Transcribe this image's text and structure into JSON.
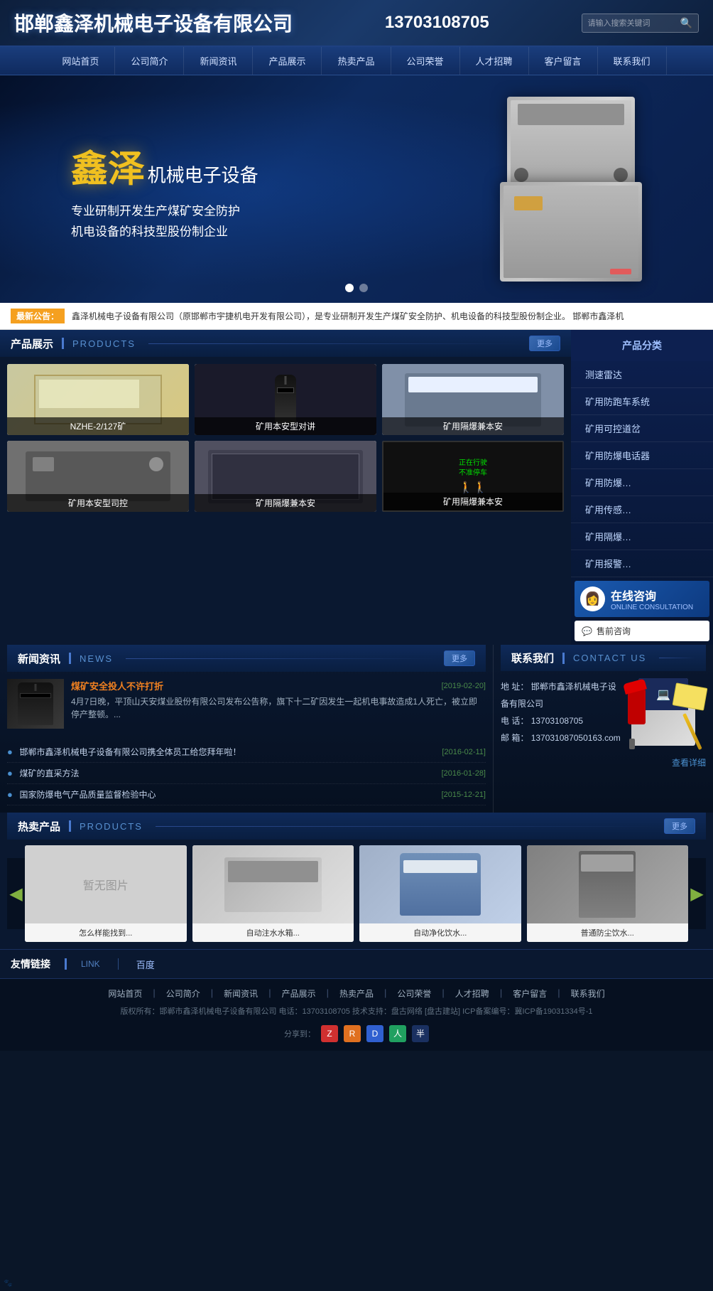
{
  "header": {
    "logo": "邯郸鑫泽机械电子设备有限公司",
    "phone": "13703108705",
    "search_placeholder": "请输入搜索关键词"
  },
  "nav": {
    "items": [
      {
        "label": "网站首页",
        "id": "home"
      },
      {
        "label": "公司简介",
        "id": "about"
      },
      {
        "label": "新闻资讯",
        "id": "news"
      },
      {
        "label": "产品展示",
        "id": "products"
      },
      {
        "label": "热卖产品",
        "id": "hot"
      },
      {
        "label": "公司荣誉",
        "id": "honor"
      },
      {
        "label": "人才招聘",
        "id": "jobs"
      },
      {
        "label": "客户留言",
        "id": "message"
      },
      {
        "label": "联系我们",
        "id": "contact"
      }
    ]
  },
  "banner": {
    "brand_name": "鑫泽",
    "brand_suffix": "机械电子设备",
    "slogan1": "专业研制开发生产煤矿安全防护",
    "slogan2": "机电设备的科技型股份制企业"
  },
  "notice": {
    "label": "最新公告：",
    "text": "鑫泽机械电子设备有限公司（原邯郸市宇捷机电开发有限公司），是专业研制开发生产煤矿安全防护、机电设备的科技型股份制企业。    邯郸市鑫泽机"
  },
  "products_section": {
    "title_zh": "产品展示",
    "title_en": "PRODUCTS",
    "more_label": "更多",
    "items": [
      {
        "label": "NZHE-2/127矿",
        "img_style": "prod-img-1"
      },
      {
        "label": "矿用本安型对讲",
        "img_style": "prod-img-2"
      },
      {
        "label": "矿用隔爆兼本安",
        "img_style": "prod-img-3"
      },
      {
        "label": "矿用本安型司控",
        "img_style": "prod-img-4"
      },
      {
        "label": "矿用隔爆兼本安",
        "img_style": "prod-img-5"
      },
      {
        "label": "矿用隔爆兼本安",
        "img_style": "prod-img-6"
      }
    ]
  },
  "sidebar": {
    "title": "产品分类",
    "items": [
      "测速雷达",
      "矿用防跑车系统",
      "矿用可控道岔",
      "矿用防爆电话器",
      "矿用防爆…",
      "矿用传感…",
      "矿用隔爆…",
      "矿用报警…"
    ],
    "online_consult_zh": "在线咨询",
    "online_consult_en": "ONLINE CONSULTATION",
    "presale_label": "售前咨询"
  },
  "news_section": {
    "title_zh": "新闻资讯",
    "title_en": "NEWS",
    "more_label": "更多",
    "main_news": {
      "title": "煤矿安全投人不许打折",
      "date": "[2019-02-20]",
      "desc": "4月7日晚，平顶山天安煤业股份有限公司发布公告称，旗下十二矿因发生一起机电事故造成1人死亡，被立即停产整顿。..."
    },
    "list_items": [
      {
        "title": "邯郸市鑫泽机械电子设备有限公司携全体员工给您拜年啦！",
        "date": "[2016-02-11]"
      },
      {
        "title": "煤矿的直采方法",
        "date": "[2016-01-28]"
      },
      {
        "title": "国家防爆电气产品质量监督检验中心",
        "date": "[2015-12-21]"
      }
    ]
  },
  "contact_section": {
    "title_zh": "联系我们",
    "title_en": "CONTACT US",
    "address_label": "地  址：",
    "address_val": "邯郸市鑫泽机械电子设备有限公司",
    "phone_label": "电  话：",
    "phone_val": "13703108705",
    "email_label": "邮  箱：",
    "email_val": "137031087050163.com",
    "more_label": "查看详细"
  },
  "hot_products": {
    "title_zh": "热卖产品",
    "title_en": "PRODUCTS",
    "more_label": "更多",
    "items": [
      {
        "label": "怎么样能找到...",
        "img_style": "hp-img-1",
        "no_img_text": "暂无图片"
      },
      {
        "label": "自动注水水箱...",
        "img_style": "hp-img-2"
      },
      {
        "label": "自动净化饮水...",
        "img_style": "hp-img-3"
      },
      {
        "label": "普通防尘饮水...",
        "img_style": "hp-img-4"
      }
    ]
  },
  "friend_links": {
    "title_zh": "友情链接",
    "divider": "LINK",
    "items": [
      "百度"
    ]
  },
  "footer": {
    "nav_items": [
      "网站首页",
      "公司简介",
      "新闻资讯",
      "产品展示",
      "热卖产品",
      "公司荣誉",
      "人才招聘",
      "客户留言",
      "联系我们"
    ],
    "copyright": "版权所有：邯郸市鑫泽机械电子设备有限公司  电话：13703108705  技术支持：盘古网络 [盘古建站]  ICP备案编号：冀ICP备19031334号-1",
    "share_label": "分享到："
  }
}
